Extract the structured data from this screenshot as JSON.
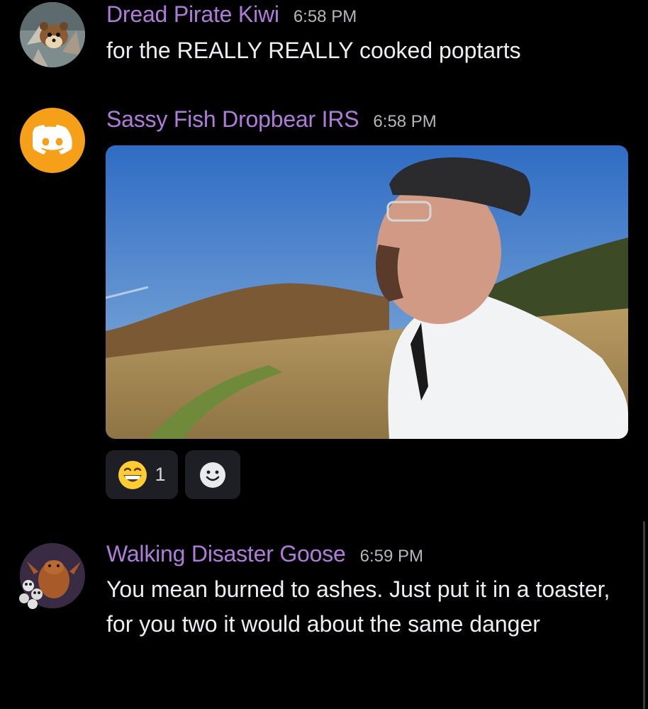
{
  "messages": [
    {
      "username": "Dread Pirate Kiwi",
      "timestamp": "6:58 PM",
      "text": "for the REALLY REALLY cooked poptarts",
      "avatar_icon": "pine-marten-avatar"
    },
    {
      "username": "Sassy Fish Dropbear IRS",
      "timestamp": "6:58 PM",
      "avatar_icon": "discord-logo-avatar",
      "avatar_color": "#f6a01a",
      "reactions": [
        {
          "emoji": "grinning-face",
          "count": "1"
        }
      ]
    },
    {
      "username": "Walking Disaster Goose",
      "timestamp": "6:59 PM",
      "text": "You mean burned to ashes. Just put it in a toaster, for you two it would about the same danger",
      "avatar_icon": "goose-with-skulls-avatar"
    }
  ],
  "colors": {
    "background": "#000000",
    "username": "#b07cdc",
    "timestamp": "#b5b6bd",
    "reaction_bg": "#1e1f24"
  }
}
